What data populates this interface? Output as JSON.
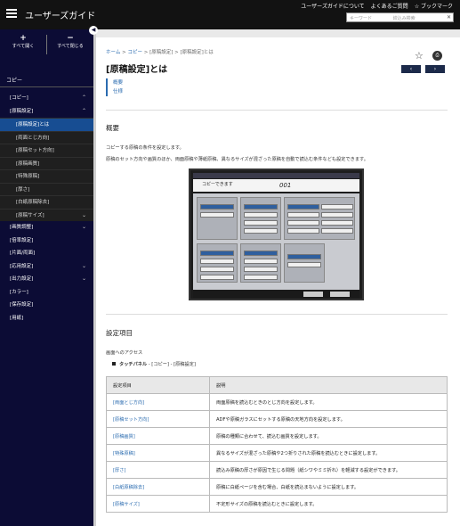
{
  "header": {
    "title": "ユーザーズガイド",
    "links": [
      "ユーザーズガイドについて",
      "よくあるご質問",
      "ブックマーク"
    ],
    "search_placeholder": "キーワード",
    "search_scope": "絞込み検索"
  },
  "sidebar": {
    "expand_all": "すべて開く",
    "collapse_all": "すべて閉じる",
    "section": "コピー",
    "items": [
      {
        "label": "[コピー]",
        "level": 0,
        "chevron": "up"
      },
      {
        "label": "[原稿設定]",
        "level": 0,
        "chevron": "up"
      },
      {
        "label": "[原稿設定]とは",
        "level": 1,
        "active": true
      },
      {
        "label": "[両面とじ方向]",
        "level": 1
      },
      {
        "label": "[原稿セット方向]",
        "level": 1
      },
      {
        "label": "[原稿画質]",
        "level": 1
      },
      {
        "label": "[特殊原稿]",
        "level": 1
      },
      {
        "label": "[厚さ]",
        "level": 1
      },
      {
        "label": "[白紙原稿除去]",
        "level": 1
      },
      {
        "label": "[原稿サイズ]",
        "level": 1,
        "chevron": "down"
      },
      {
        "label": "[画質調整]",
        "level": 0,
        "chevron": "down"
      },
      {
        "label": "[倍率設定]",
        "level": 0
      },
      {
        "label": "[片面/両面]",
        "level": 0
      },
      {
        "label": "[応用設定]",
        "level": 0,
        "chevron": "down"
      },
      {
        "label": "[出力設定]",
        "level": 0,
        "chevron": "down"
      },
      {
        "label": "[カラー]",
        "level": 0
      },
      {
        "label": "[保存設定]",
        "level": 0
      },
      {
        "label": "[用紙]",
        "level": 0
      }
    ]
  },
  "main": {
    "breadcrumb": [
      "ホーム",
      "コピー",
      "[原稿設定]",
      "[原稿設定]とは"
    ],
    "title": "[原稿設定]とは",
    "toc": [
      "概要",
      "仕様"
    ],
    "section1_title": "概要",
    "para1": "コピーする原稿の条件を設定します。",
    "para2": "原稿のセット方向や画質のほか、両面原稿や薄紙原稿、異なるサイズが混ざった原稿を自動で読込む条件なども設定できます。",
    "panel": {
      "status": "コピーできます",
      "counter": "001"
    },
    "section2_title": "設定項目",
    "access_label": "画面へのアクセス",
    "access_path_bold": "タッチパネル",
    "access_path_rest": " - [コピー] - [原稿設定]",
    "table": {
      "headers": [
        "設定項目",
        "説明"
      ],
      "rows": [
        [
          "[両面とじ方向]",
          "両面原稿を読込むときのとじ方向を設定します。"
        ],
        [
          "[原稿セット方向]",
          "ADFや原稿ガラスにセットする原稿の天地方向を設定します。"
        ],
        [
          "[原稿画質]",
          "原稿の種類に合わせて、読込む画質を設定します。"
        ],
        [
          "[特殊原稿]",
          "異なるサイズが混ざった原稿や2つ折りされた原稿を読込むときに設定します。"
        ],
        [
          "[厚さ]",
          "読込み原稿の厚さが原因で生じる問題（紙シワやミミ折れ）を軽減する設定ができます。"
        ],
        [
          "[白紙原稿除去]",
          "原稿に白紙ページを含む場合、白紙を読込まないように設定します。"
        ],
        [
          "[原稿サイズ]",
          "不定形サイズの原稿を読込むときに設定します。"
        ]
      ]
    }
  }
}
